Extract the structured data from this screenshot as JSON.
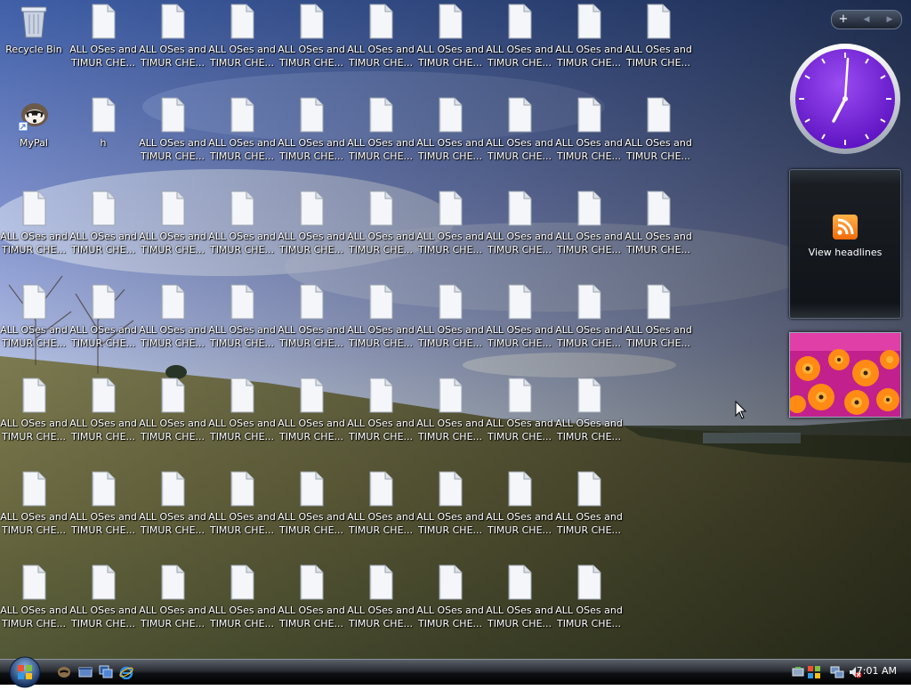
{
  "desktop": {
    "recycle_bin_label": "Recycle Bin",
    "mypal_label": "MyPal",
    "h_label": "h",
    "file_label_line1": "ALL OSes and",
    "file_label_line2": "TIMUR CHE...",
    "file_icon": "text-document-icon",
    "file_count": 64
  },
  "sidebar": {
    "add_button": "+",
    "prev_button": "◀",
    "next_button": "▶",
    "clock": {
      "time": "7:01",
      "face_color": "#7a1ee0"
    },
    "feed": {
      "label": "View headlines",
      "icon": "rss-feed-icon"
    },
    "slideshow": {
      "subject": "orange flowers"
    }
  },
  "taskbar": {
    "start_icon": "windows-orb-icon",
    "quick_launch": [
      "mypal-icon",
      "show-desktop-icon",
      "switch-windows-icon",
      "internet-explorer-icon"
    ],
    "tray_icons": [
      "safely-remove-icon",
      "security-center-icon",
      "network-icon",
      "volume-muted-icon"
    ],
    "clock": "7:01 AM"
  },
  "colors": {
    "taskbar_bg": "#101215",
    "clock_face": "#7a1ee0",
    "rss_orange": "#f57c00"
  }
}
